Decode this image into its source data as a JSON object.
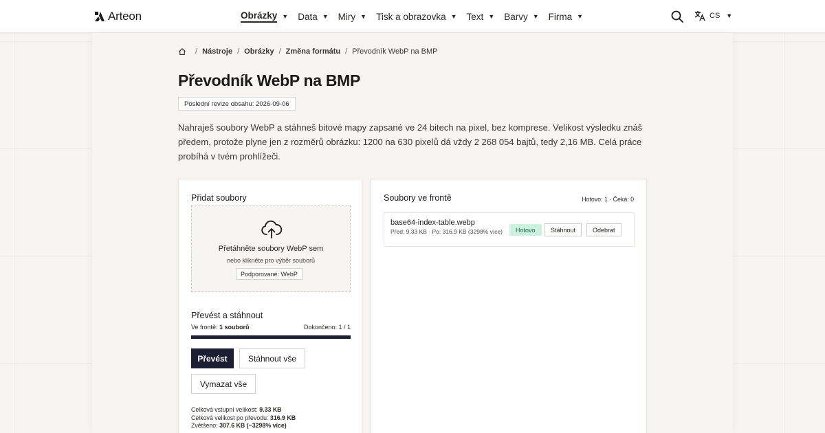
{
  "header": {
    "logo": "Arteon",
    "nav": [
      {
        "label": "Obrázky",
        "active": true
      },
      {
        "label": "Data"
      },
      {
        "label": "Miry"
      },
      {
        "label": "Tisk a obrazovka"
      },
      {
        "label": "Text"
      },
      {
        "label": "Barvy"
      },
      {
        "label": "Firma"
      }
    ],
    "lang": "CS"
  },
  "breadcrumb": {
    "items": [
      "Nástroje",
      "Obrázky",
      "Změna formátu"
    ],
    "current": "Převodník WebP na BMP"
  },
  "page": {
    "title": "Převodník WebP na BMP",
    "revision": "Poslední revize obsahu: 2026-09-06",
    "intro": "Nahraješ soubory WebP a stáhneš bitové mapy zapsané ve 24 bitech na pixel, bez komprese. Velikost výsledku znáš předem, protože plyne jen z rozměrů obrázku: 1200 na 630 pixelů dá vždy 2 268 054 bajtů, tedy 2,16 MB. Celá práce probíhá v tvém prohlížeči."
  },
  "upload": {
    "title": "Přidat soubory",
    "drop_title": "Přetáhněte soubory WebP sem",
    "drop_sub": "nebo klikněte pro výběr souborů",
    "supported": "Podporované: WebP"
  },
  "convert": {
    "title": "Převést a stáhnout",
    "queue_label": "Ve frontě:",
    "queue_value": "1 souborů",
    "done": "Dokončeno: 1 / 1",
    "progress": 1.0,
    "btn_convert": "Převést",
    "btn_download_all": "Stáhnout vše",
    "btn_clear": "Vymazat vše",
    "stats": [
      {
        "label": "Celková vstupní velikost: ",
        "value": "9.33 KB"
      },
      {
        "label": "Celková velikost po převodu: ",
        "value": "316.9 KB"
      },
      {
        "label": "Zvětšeno: ",
        "value": "307.6 KB (~3298% více)"
      }
    ]
  },
  "queue": {
    "title": "Soubory ve frontě",
    "status": "Hotovo: 1 · Čeká: 0",
    "files": [
      {
        "name": "base64-index-table.webp",
        "meta": "Před: 9.33 KB · Po: 316.9 KB (3298% více)",
        "status": "Hotovo",
        "download": "Stáhnout",
        "remove": "Odebrat"
      }
    ]
  },
  "colors": {
    "accent": "#1c1f33",
    "success_bg": "#cdf1e1",
    "success_text": "#1f6a47",
    "background": "#f8f4f1"
  },
  "icons": [
    "logo-icon",
    "search-icon",
    "translate-icon",
    "home-icon",
    "upload-cloud-icon"
  ]
}
